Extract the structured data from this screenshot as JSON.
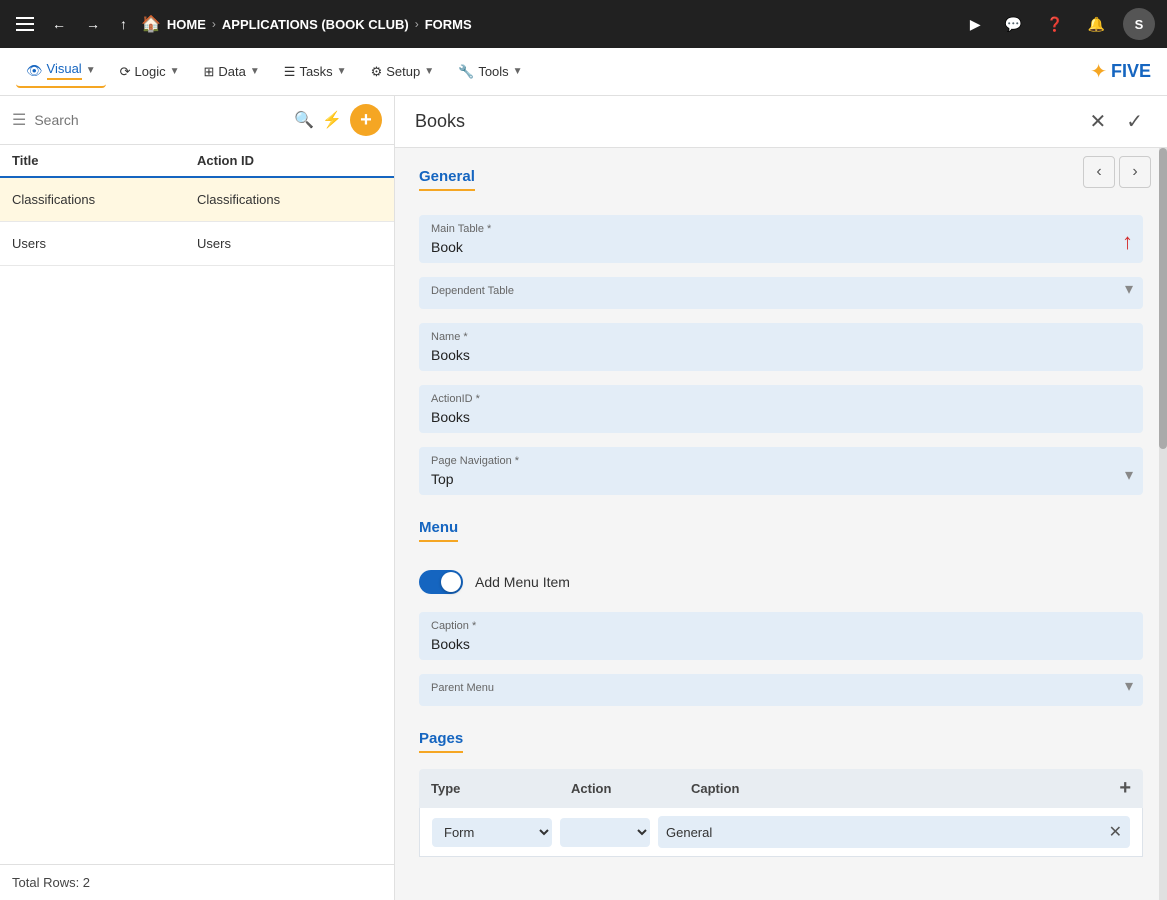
{
  "topNav": {
    "home_label": "HOME",
    "app_label": "APPLICATIONS (BOOK CLUB)",
    "forms_label": "FORMS",
    "user_initial": "S"
  },
  "toolbar": {
    "visual_label": "Visual",
    "logic_label": "Logic",
    "data_label": "Data",
    "tasks_label": "Tasks",
    "setup_label": "Setup",
    "tools_label": "Tools"
  },
  "leftPanel": {
    "search_placeholder": "Search",
    "col_title": "Title",
    "col_action_id": "Action ID",
    "items": [
      {
        "title": "Classifications",
        "action_id": "Classifications"
      },
      {
        "title": "Users",
        "action_id": "Users"
      }
    ],
    "total_rows": "Total Rows: 2"
  },
  "rightPanel": {
    "title": "Books",
    "tabs": {
      "general": "General",
      "menu": "Menu",
      "pages": "Pages"
    },
    "general": {
      "main_table_label": "Main Table *",
      "main_table_value": "Book",
      "dependent_table_label": "Dependent Table",
      "dependent_table_value": "",
      "name_label": "Name *",
      "name_value": "Books",
      "action_id_label": "ActionID *",
      "action_id_value": "Books",
      "page_nav_label": "Page Navigation *",
      "page_nav_value": "Top"
    },
    "menu": {
      "section_label": "Menu",
      "add_menu_label": "Add Menu Item",
      "caption_label": "Caption *",
      "caption_value": "Books",
      "parent_menu_label": "Parent Menu",
      "parent_menu_value": ""
    },
    "pages": {
      "section_label": "Pages",
      "col_type": "Type",
      "col_action": "Action",
      "col_caption": "Caption",
      "row_type": "Form",
      "row_action": "",
      "row_caption": "General"
    }
  }
}
